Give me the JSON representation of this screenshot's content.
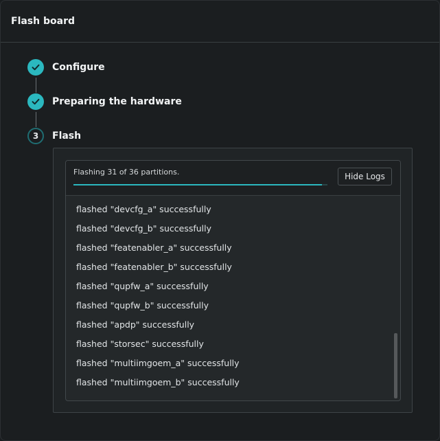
{
  "dialog": {
    "title": "Flash board"
  },
  "steps": [
    {
      "label": "Configure",
      "state": "done",
      "icon": "checkmark-icon"
    },
    {
      "label": "Preparing the hardware",
      "state": "done",
      "icon": "checkmark-icon"
    },
    {
      "label": "Flash",
      "state": "active",
      "number": "3"
    }
  ],
  "flash": {
    "progress_text": "Flashing 31 of 36 partitions.",
    "progress": 0.978,
    "hide_logs_label": "Hide Logs",
    "log_lines": [
      "flashed \"devcfg_a\" successfully",
      "flashed \"devcfg_b\" successfully",
      "flashed \"featenabler_a\" successfully",
      "flashed \"featenabler_b\" successfully",
      "flashed \"qupfw_a\" successfully",
      "flashed \"qupfw_b\" successfully",
      "flashed \"apdp\" successfully",
      "flashed \"storsec\" successfully",
      "flashed \"multiimgoem_a\" successfully",
      "flashed \"multiimgoem_b\" successfully"
    ]
  },
  "colors": {
    "accent": "#2bb8bf",
    "background": "#1b1e20"
  }
}
